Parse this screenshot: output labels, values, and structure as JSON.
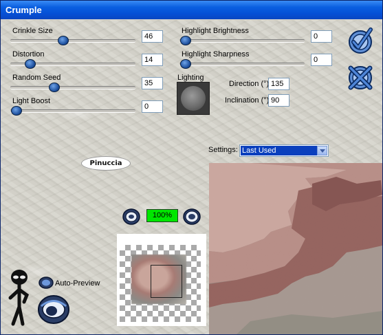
{
  "window": {
    "title": "Crumple"
  },
  "sliders_left": [
    {
      "label": "Crinkle Size",
      "value": "46",
      "fraction": 0.41
    },
    {
      "label": "Distortion",
      "value": "14",
      "fraction": 0.12
    },
    {
      "label": "Random Seed",
      "value": "35",
      "fraction": 0.33
    },
    {
      "label": "Light Boost",
      "value": "0",
      "fraction": 0.0
    }
  ],
  "sliders_right": [
    {
      "label": "Highlight Brightness",
      "value": "0",
      "fraction": 0.0
    },
    {
      "label": "Highlight Sharpness",
      "value": "0",
      "fraction": 0.0
    }
  ],
  "lighting": {
    "label": "Lighting",
    "direction_label": "Direction (°)",
    "direction_value": "135",
    "inclination_label": "Inclination (°)",
    "inclination_value": "90"
  },
  "settings": {
    "label": "Settings:",
    "selected": "Last Used"
  },
  "zoom": {
    "value": "100%"
  },
  "auto_preview": {
    "label": "Auto-Preview"
  },
  "watermark": "Pinuccia",
  "colors": {
    "title_bar": "#0550d6",
    "accent_blue": "#1c4e9c",
    "zoom_green": "#00e600",
    "selected": "#0a3fbd"
  },
  "icons": {
    "ok": "checkmark-icon",
    "cancel": "x-cancel-icon",
    "zoom_in": "zoom-in-icon",
    "zoom_out": "zoom-out-icon",
    "preview": "eye-icon",
    "mascot": "alien-figure-icon"
  }
}
